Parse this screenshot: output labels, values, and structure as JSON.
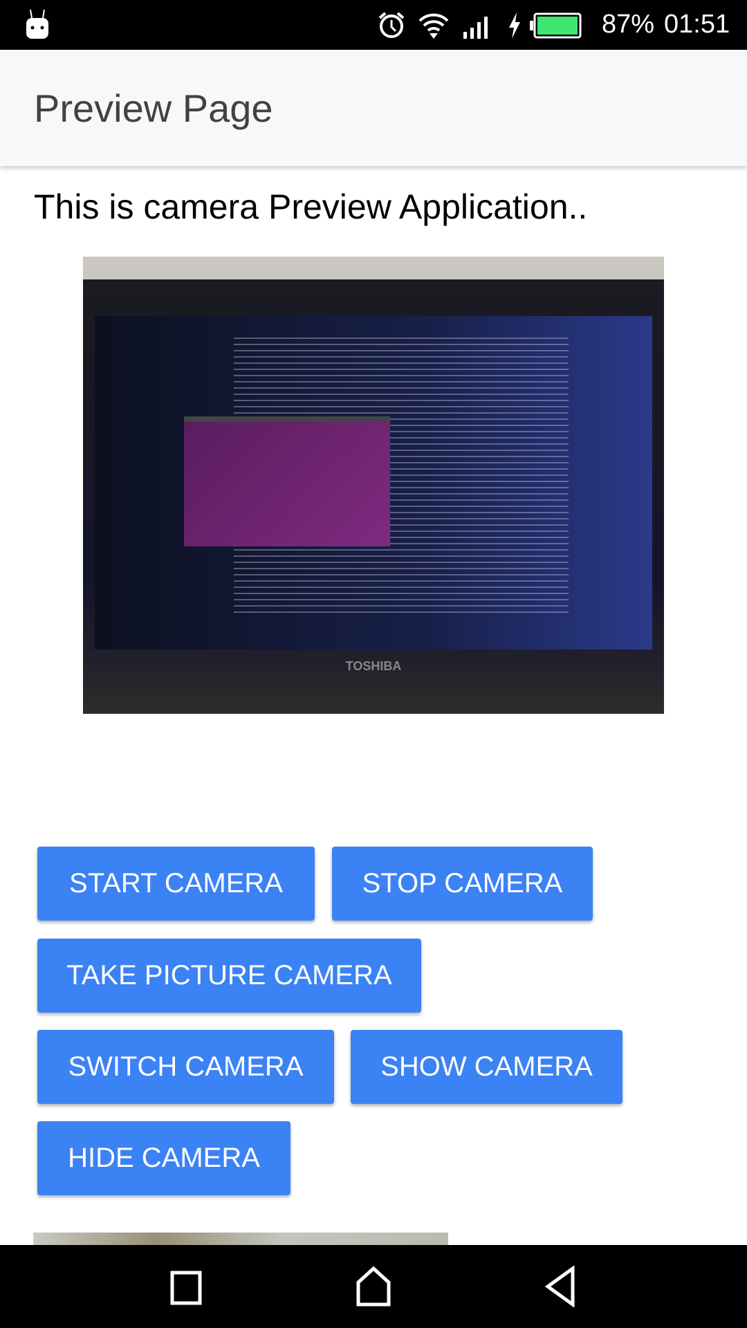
{
  "status_bar": {
    "battery": "87%",
    "time": "01:51",
    "battery_level": 87,
    "icons": [
      "android-notification-icon",
      "alarm-icon",
      "wifi-icon",
      "signal-icon",
      "charging-icon",
      "battery-icon"
    ],
    "battery_color": "#3ee870"
  },
  "app_bar": {
    "title": "Preview Page"
  },
  "content": {
    "heading": "This is camera Preview Application.."
  },
  "buttons": {
    "start": "START CAMERA",
    "stop": "STOP CAMERA",
    "take_picture": "TAKE PICTURE CAMERA",
    "switch": "SWITCH CAMERA",
    "show": "SHOW CAMERA",
    "hide": "HIDE CAMERA",
    "color": "#3b82f4"
  },
  "preview": {
    "brand": "TOSHIBA"
  },
  "nav_bar": {
    "icons": [
      "recents-icon",
      "home-icon",
      "back-icon"
    ]
  }
}
